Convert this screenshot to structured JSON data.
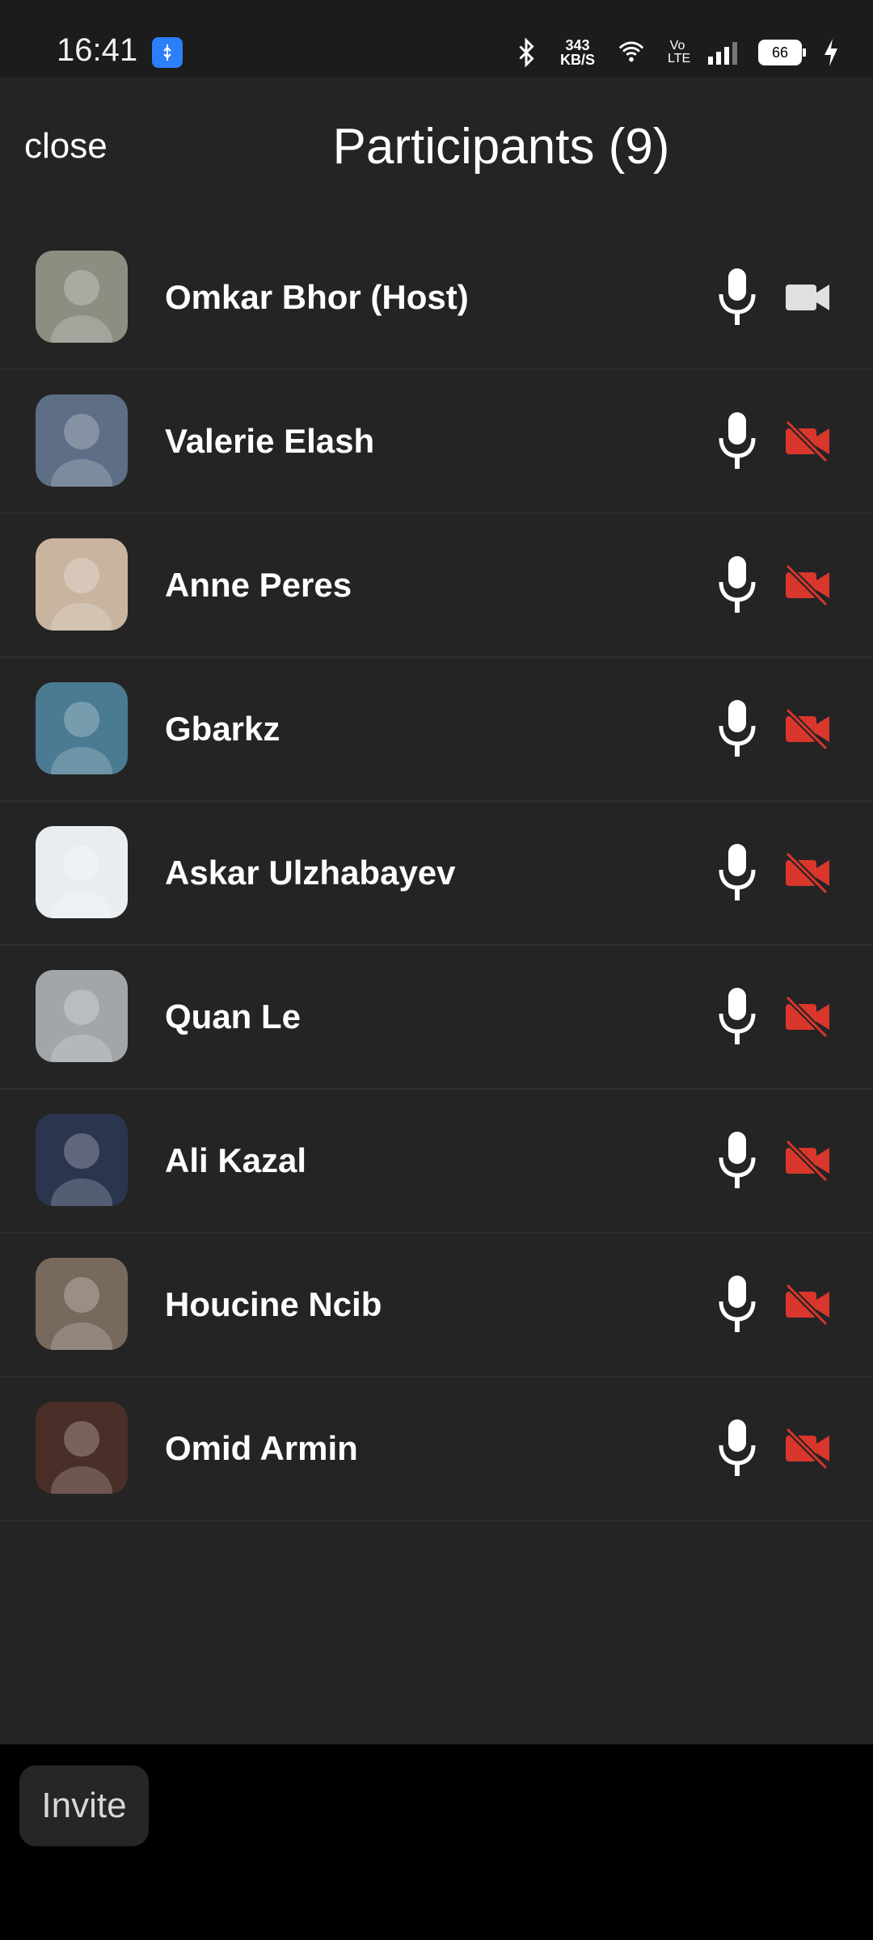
{
  "status_bar": {
    "time": "16:41",
    "network_speed": "343",
    "network_unit": "KB/S",
    "battery": "66",
    "volte": "Vo LTE"
  },
  "header": {
    "close_label": "close",
    "title": "Participants (9)"
  },
  "participants": [
    {
      "name": "Omkar Bhor (Host)",
      "video_muted": false,
      "avatar_color": "#8a8f82"
    },
    {
      "name": "Valerie Elash",
      "video_muted": true,
      "avatar_color": "#5d6e86"
    },
    {
      "name": "Anne Peres",
      "video_muted": true,
      "avatar_color": "#c9b4a0"
    },
    {
      "name": "Gbarkz",
      "video_muted": true,
      "avatar_color": "#4a7b92"
    },
    {
      "name": "Askar Ulzhabayev",
      "video_muted": true,
      "avatar_color": "#e9edf2"
    },
    {
      "name": "Quan Le",
      "video_muted": true,
      "avatar_color": "#a2a6ab"
    },
    {
      "name": "Ali Kazal",
      "video_muted": true,
      "avatar_color": "#2b3550"
    },
    {
      "name": "Houcine Ncib",
      "video_muted": true,
      "avatar_color": "#776a5d"
    },
    {
      "name": "Omid Armin",
      "video_muted": true,
      "avatar_color": "#4a2e28"
    }
  ],
  "footer": {
    "invite_label": "Invite"
  },
  "colors": {
    "background": "#242424",
    "muted_video": "#d9362c",
    "icon": "#ffffff"
  }
}
